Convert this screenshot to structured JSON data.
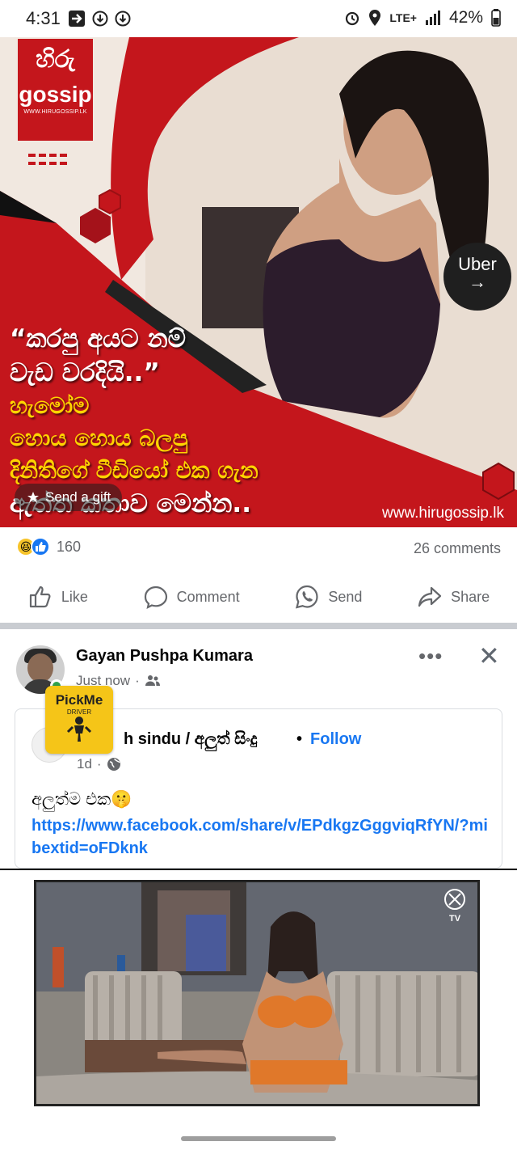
{
  "status_bar": {
    "time": "4:31",
    "network": "LTE+",
    "battery": "42%"
  },
  "post1": {
    "brand": {
      "top": "හිරු",
      "name": "gossip",
      "url": "WWW.HIRUGOSSIP.LK"
    },
    "headline": {
      "line1": "“කරපු අයට නම්",
      "line2": "වැඩ වරදියි..”",
      "line3": "හැමෝම",
      "line4": "හොය හොය බලපු",
      "line5": "දිනිතිගේ වීඩියෝ එක ගැන",
      "line6": "ඇත්ත කතාව මෙන්න.."
    },
    "image_url": "www.hirugossip.lk",
    "uber_label": "Uber",
    "uber_arrow": "→",
    "gift_label": "Send a gift",
    "reaction_count": "160",
    "comments_count": "26 comments",
    "actions": {
      "like": "Like",
      "comment": "Comment",
      "send": "Send",
      "share": "Share"
    }
  },
  "post2": {
    "author": "Gayan Pushpa Kumara",
    "time": "Just now",
    "more": "•••",
    "close": "✕",
    "ad": {
      "logo": "PickMe",
      "sub": "DRIVER"
    },
    "shared": {
      "page_name": "h sindu / අලුත් සිංදු",
      "separator": "•",
      "follow": "Follow",
      "time": "1d",
      "text": "අලුත්ම එක🤫",
      "link": "https://www.facebook.com/share/v/EPdkgzGggviqRfYN/?mibextid=oFDknk"
    },
    "video": {
      "channel_logo": "TV"
    }
  },
  "colors": {
    "accent_blue": "#1877f2",
    "brand_red": "#c4161c",
    "headline_yellow": "#ffd400",
    "meta_gray": "#65676b"
  }
}
